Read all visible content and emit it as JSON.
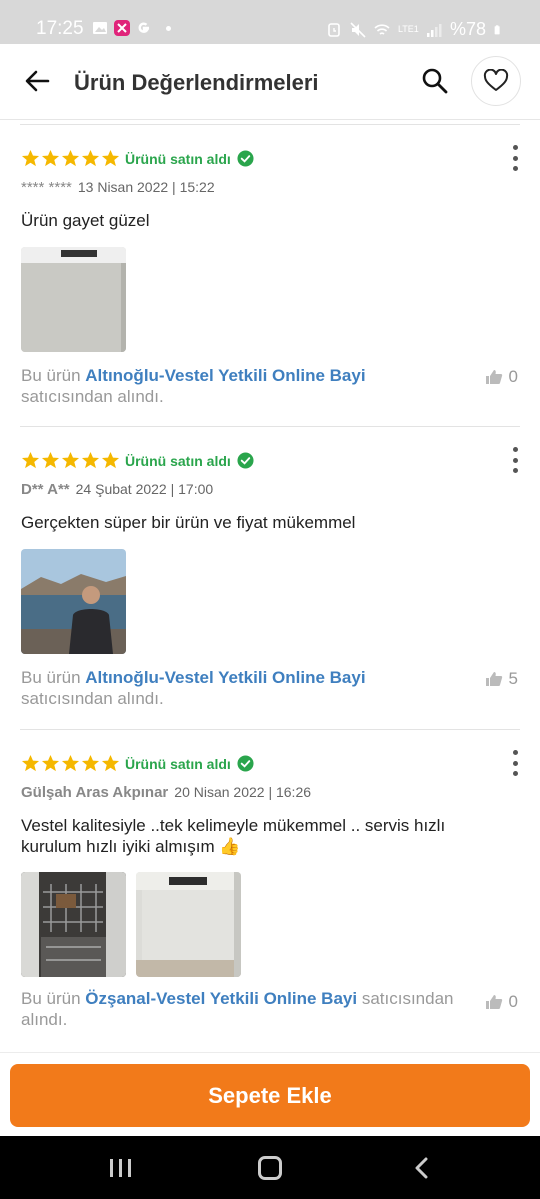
{
  "status_bar": {
    "time": "17:25",
    "battery": "%78",
    "network": "LTE1",
    "icons_left": [
      "gallery-icon",
      "app-notification-icon",
      "google-icon",
      "more-dot-icon"
    ],
    "icons_right": [
      "alarm-icon",
      "mute-icon",
      "wifi-icon",
      "signal-icon",
      "battery-icon"
    ]
  },
  "app_bar": {
    "title": "Ürün Değerlendirmeleri"
  },
  "reviews": [
    {
      "rating": 5,
      "bought_label": "Ürünü satın aldı",
      "author": "**** ****",
      "date": "13 Nisan 2022 | 15:22",
      "comment": "Ürün gayet güzel",
      "images": [
        "dishwasher-photo"
      ],
      "seller_prefix": "Bu ürün",
      "seller_name": "Altınoğlu-Vestel Yetkili Online Bayi",
      "seller_suffix": "satıcısından alındı.",
      "likes": "0"
    },
    {
      "rating": 5,
      "bought_label": "Ürünü satın aldı",
      "author": "D** A**",
      "date": "24 Şubat 2022 | 17:00",
      "comment": "Gerçekten süper bir ürün ve fiyat mükemmel",
      "images": [
        "person-lake-photo"
      ],
      "seller_prefix": "Bu ürün",
      "seller_name": "Altınoğlu-Vestel Yetkili Online Bayi",
      "seller_suffix": "satıcısından alındı.",
      "likes": "5"
    },
    {
      "rating": 5,
      "bought_label": "Ürünü satın aldı",
      "author": "Gülşah Aras Akpınar",
      "date": "20 Nisan 2022 | 16:26",
      "comment": "Vestel kalitesiyle ..tek kelimeyle mükemmel .. servis hızlı kurulum hızlı iyiki almışım 👍",
      "images": [
        "dishwasher-open-photo",
        "dishwasher-closed-photo"
      ],
      "seller_prefix": "Bu ürün",
      "seller_name": "Özşanal-Vestel Yetkili Online Bayi",
      "seller_suffix": "satıcısından alındı.",
      "likes": "0"
    }
  ],
  "cart_button": {
    "label": "Sepete Ekle",
    "color": "#f27a1a"
  },
  "colors": {
    "star": "#f5b800",
    "bought": "#2aa54c",
    "seller_link": "#3f7fbf"
  }
}
